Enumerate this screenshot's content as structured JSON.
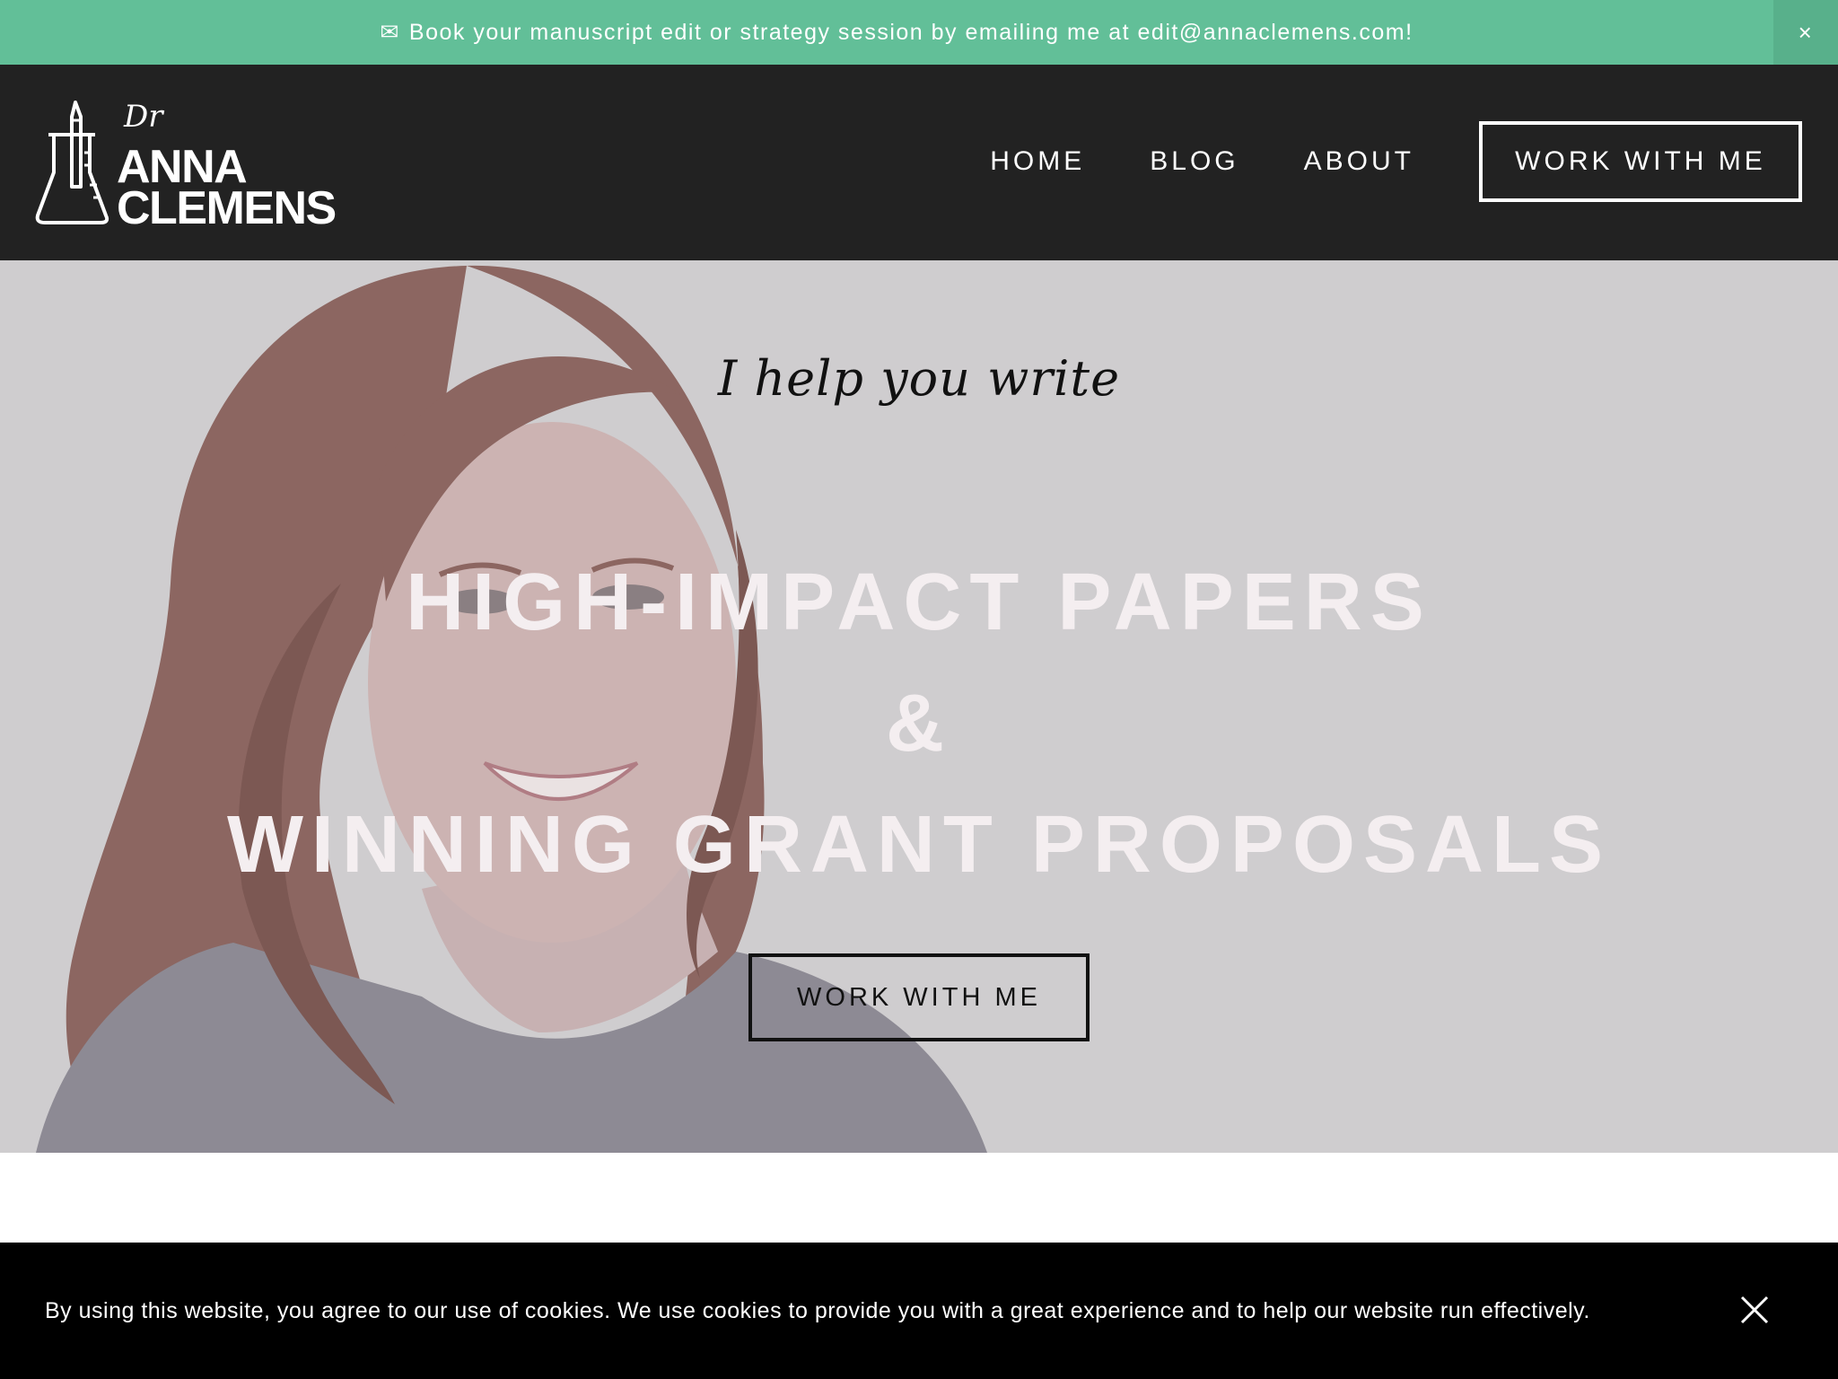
{
  "announcement": {
    "icon": "envelope-icon",
    "envelope_glyph": "✉",
    "text": "Book your manuscript edit or strategy session by emailing me at edit@annaclemens.com!",
    "close_glyph": "×"
  },
  "header": {
    "logo": {
      "prefix": "Dr",
      "line1": "ANNA",
      "line2": "CLEMENS"
    },
    "nav": {
      "home": "HOME",
      "blog": "BLOG",
      "about": "ABOUT",
      "cta": "WORK WITH ME"
    }
  },
  "hero": {
    "kicker": "I help you write",
    "line1": "HIGH-IMPACT PAPERS",
    "line2": "&",
    "line3": "WINNING GRANT PROPOSALS",
    "cta": "WORK WITH ME"
  },
  "cookie_banner": {
    "text": "By using this website, you agree to our use of cookies. We use cookies to provide you with a great experience and to help our website run effectively."
  },
  "colors": {
    "announcement_bg": "#62bf98",
    "header_bg": "#222222",
    "hero_overlay": "#cfcdcf",
    "cookie_bg": "#000000"
  }
}
